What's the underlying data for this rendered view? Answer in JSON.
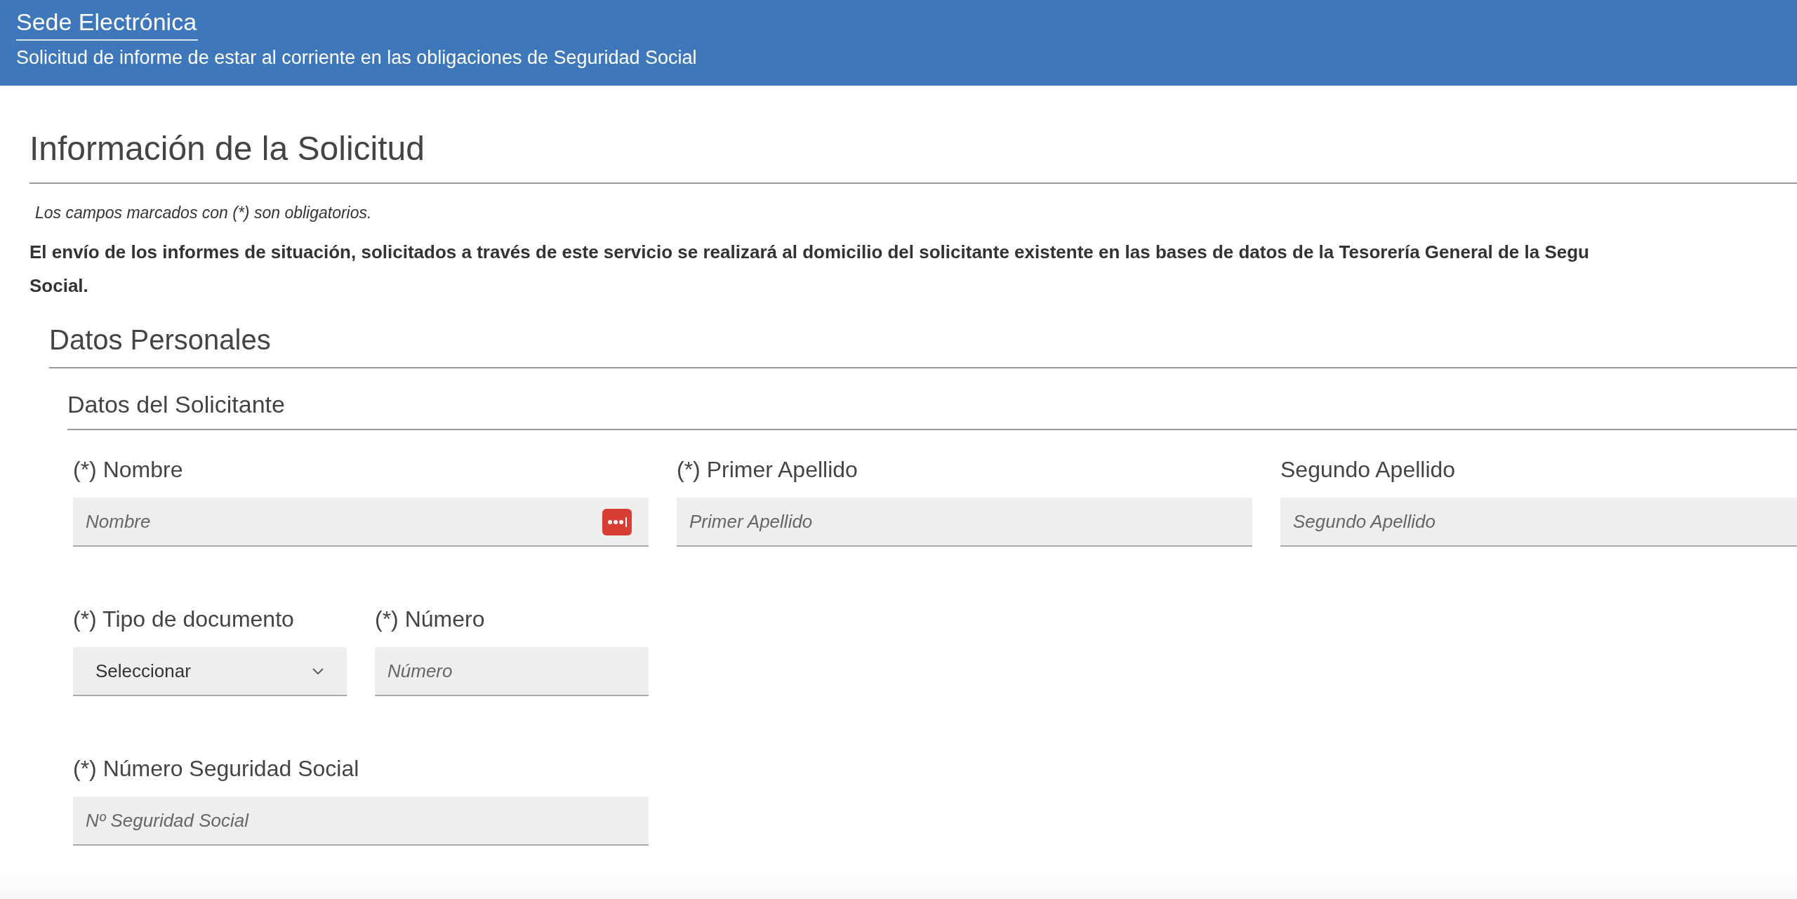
{
  "header": {
    "title": "Sede Electrónica",
    "subtitle": "Solicitud de informe de estar al corriente en las obligaciones de Seguridad Social"
  },
  "section": {
    "title": "Información de la Solicitud",
    "note": "Los campos marcados con (*) son obligatorios.",
    "notice_lines": [
      "El envío de los informes de situación, solicitados a través de este servicio se realizará al domicilio del solicitante existente en las bases de datos de la Tesorería General de la Segu",
      "Social."
    ]
  },
  "subsection": {
    "title": "Datos Personales",
    "group_title": "Datos del Solicitante",
    "rows": [
      [
        {
          "kind": "autofill",
          "label": "(*) Nombre",
          "placeholder": "Nombre"
        },
        {
          "kind": "text",
          "label": "(*) Primer Apellido",
          "placeholder": "Primer Apellido"
        },
        {
          "kind": "text",
          "label": "Segundo Apellido",
          "placeholder": "Segundo Apellido"
        }
      ],
      [
        {
          "kind": "select",
          "label": "(*) Tipo de documento",
          "value": "Seleccionar"
        },
        {
          "kind": "text",
          "label": "(*) Número",
          "placeholder": "Número"
        }
      ],
      [
        {
          "kind": "text",
          "label": "(*) Número Seguridad Social",
          "placeholder": "Nº Seguridad Social"
        }
      ]
    ]
  }
}
